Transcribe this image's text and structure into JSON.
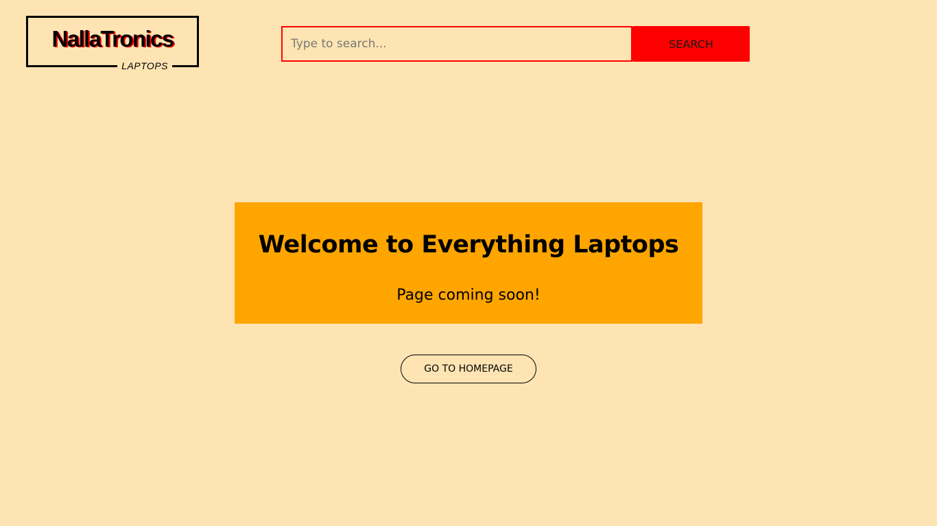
{
  "header": {
    "logo": {
      "brand": "NallaTronics",
      "tagline": "LAPTOPS"
    },
    "search": {
      "placeholder": "Type to search...",
      "value": "",
      "button_label": "SEARCH"
    }
  },
  "main": {
    "title": "Welcome to Everything Laptops",
    "subtitle": "Page coming soon!",
    "home_button_label": "GO TO HOMEPAGE"
  },
  "colors": {
    "page_background": "#ffe4b3",
    "accent_red": "#ff0000",
    "hero_orange": "#ffa500"
  }
}
